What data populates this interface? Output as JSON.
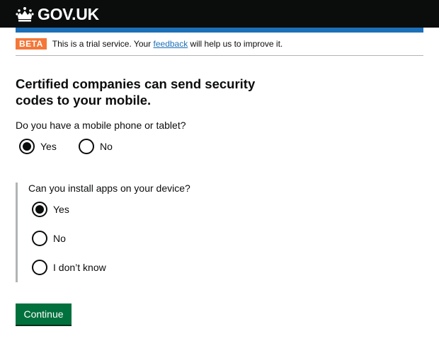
{
  "header": {
    "logo_text": "GOV.UK",
    "crown_icon": "crown-icon",
    "background": "#0b0c0c",
    "accent_bar": "#1d70b8"
  },
  "phase_banner": {
    "tag": "BETA",
    "text_before": "This is a trial service. Your ",
    "link": "feedback",
    "text_after": " will help us to improve it.",
    "tag_color": "#f47738"
  },
  "main": {
    "heading": "Certified companies can send security codes to your mobile.",
    "question1": {
      "label": "Do you have a mobile phone or tablet?",
      "options": [
        "Yes",
        "No"
      ],
      "selected": "Yes"
    },
    "question2": {
      "label": "Can you install apps on your device?",
      "options": [
        "Yes",
        "No",
        "I don’t know"
      ],
      "selected": "Yes"
    },
    "continue_label": "Continue",
    "button_color": "#00703c"
  }
}
